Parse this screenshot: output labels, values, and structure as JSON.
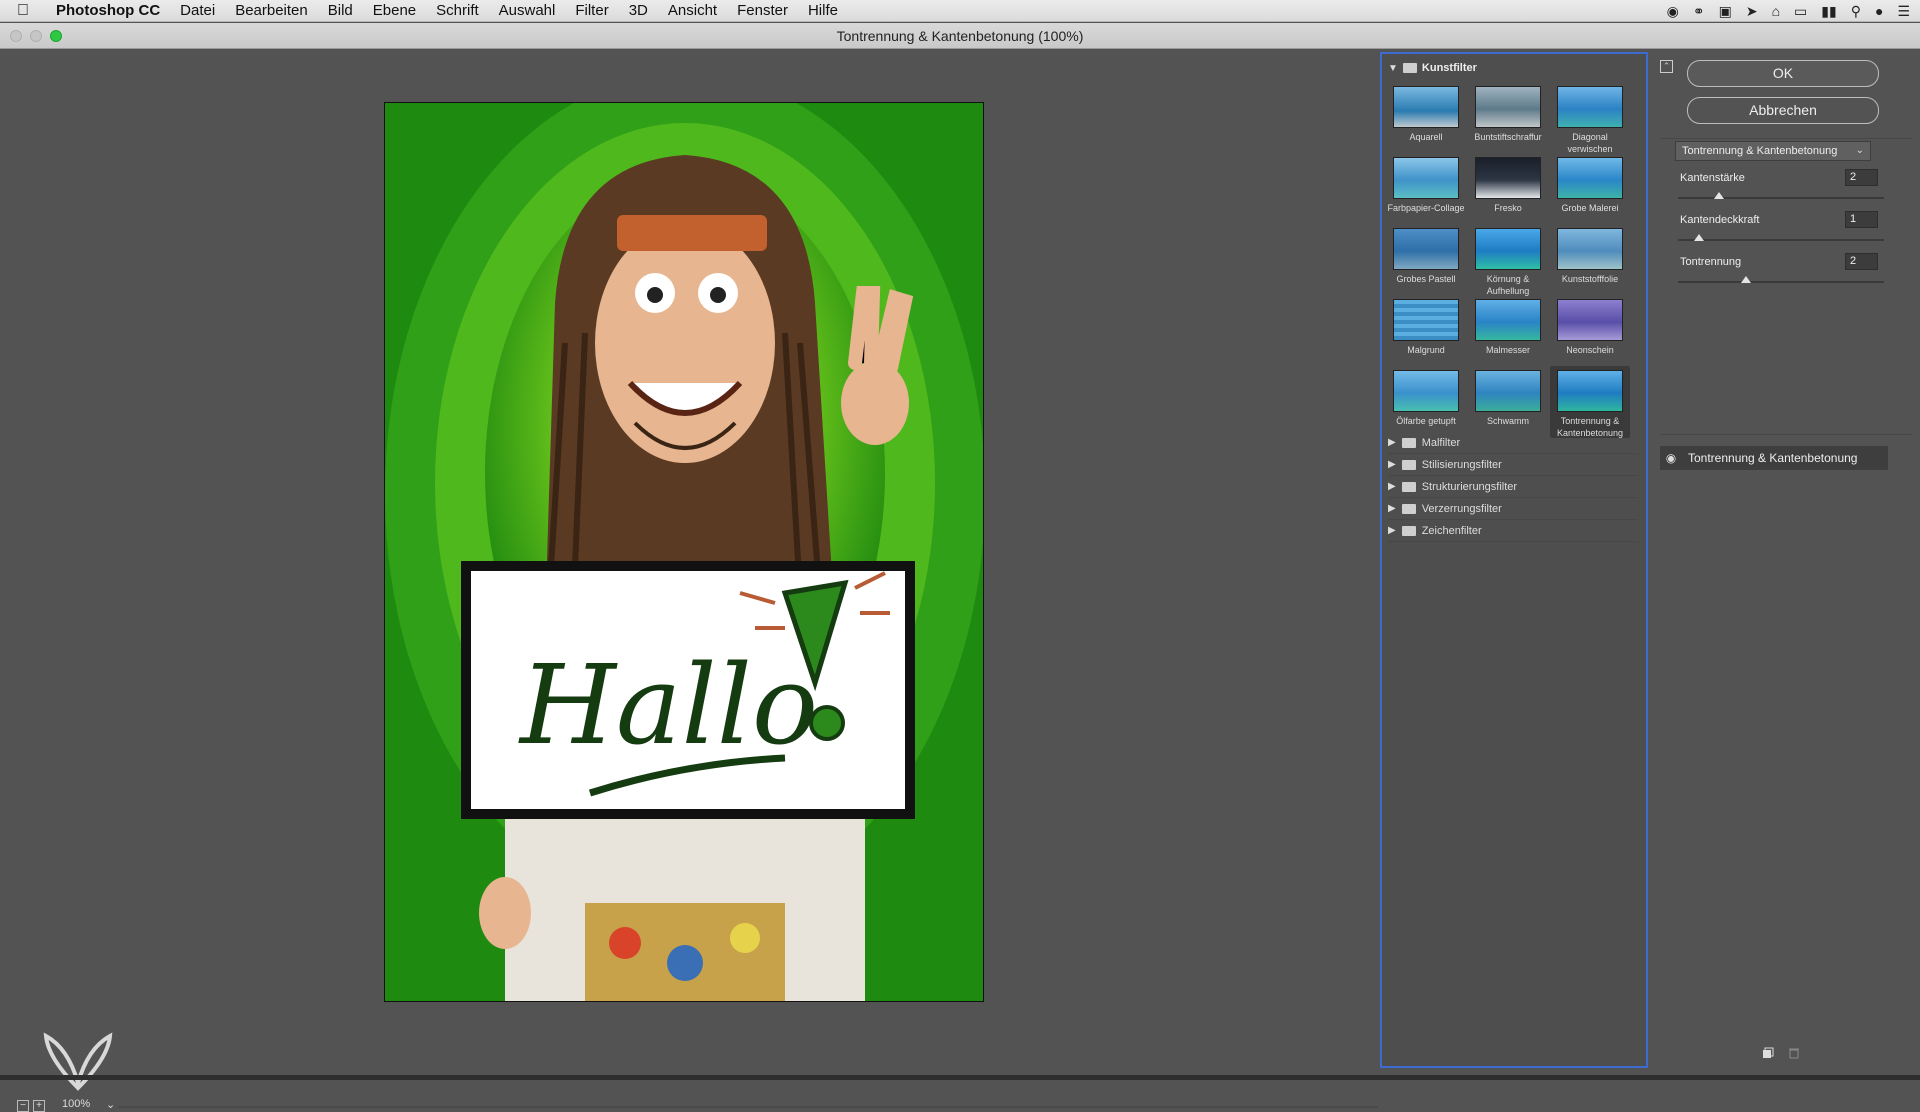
{
  "menubar": {
    "app_name": "Photoshop CC",
    "items": [
      "Datei",
      "Bearbeiten",
      "Bild",
      "Ebene",
      "Schrift",
      "Auswahl",
      "Filter",
      "3D",
      "Ansicht",
      "Fenster",
      "Hilfe"
    ],
    "status_icons": [
      "record-icon",
      "creative-cloud-icon",
      "display-icon",
      "location-icon",
      "wifi-icon",
      "airplay-icon",
      "battery-icon",
      "search-icon",
      "user-icon",
      "list-icon"
    ]
  },
  "window": {
    "title": "Tontrennung & Kantenbetonung (100%)"
  },
  "preview": {
    "zoom": "100%",
    "sign_text": "Hallo"
  },
  "gallery": {
    "open_category": "Kunstfilter",
    "filters": [
      {
        "label": "Aquarell",
        "selected": false
      },
      {
        "label": "Buntstiftschraffur",
        "selected": false
      },
      {
        "label": "Diagonal verwischen",
        "selected": false
      },
      {
        "label": "Farbpapier-Collage",
        "selected": false
      },
      {
        "label": "Fresko",
        "selected": false
      },
      {
        "label": "Grobe Malerei",
        "selected": false
      },
      {
        "label": "Grobes Pastell",
        "selected": false
      },
      {
        "label": "Körnung & Aufhellung",
        "selected": false
      },
      {
        "label": "Kunststofffolie",
        "selected": false
      },
      {
        "label": "Malgrund",
        "selected": false
      },
      {
        "label": "Malmesser",
        "selected": false
      },
      {
        "label": "Neonschein",
        "selected": false
      },
      {
        "label": "Ölfarbe getupft",
        "selected": false
      },
      {
        "label": "Schwamm",
        "selected": false
      },
      {
        "label": "Tontrennung & Kantenbetonung",
        "selected": true
      }
    ],
    "categories": [
      "Malfilter",
      "Stilisierungsfilter",
      "Strukturierungsfilter",
      "Verzerrungsfilter",
      "Zeichenfilter"
    ]
  },
  "settings": {
    "ok_label": "OK",
    "cancel_label": "Abbrechen",
    "selected_filter": "Tontrennung & Kantenbetonung",
    "params": [
      {
        "label": "Kantenstärke",
        "value": "2",
        "fraction": 0.2
      },
      {
        "label": "Kantendeckkraft",
        "value": "1",
        "fraction": 0.1
      },
      {
        "label": "Tontrennung",
        "value": "2",
        "fraction": 0.33
      }
    ],
    "effect_layer": "Tontrennung & Kantenbetonung"
  }
}
